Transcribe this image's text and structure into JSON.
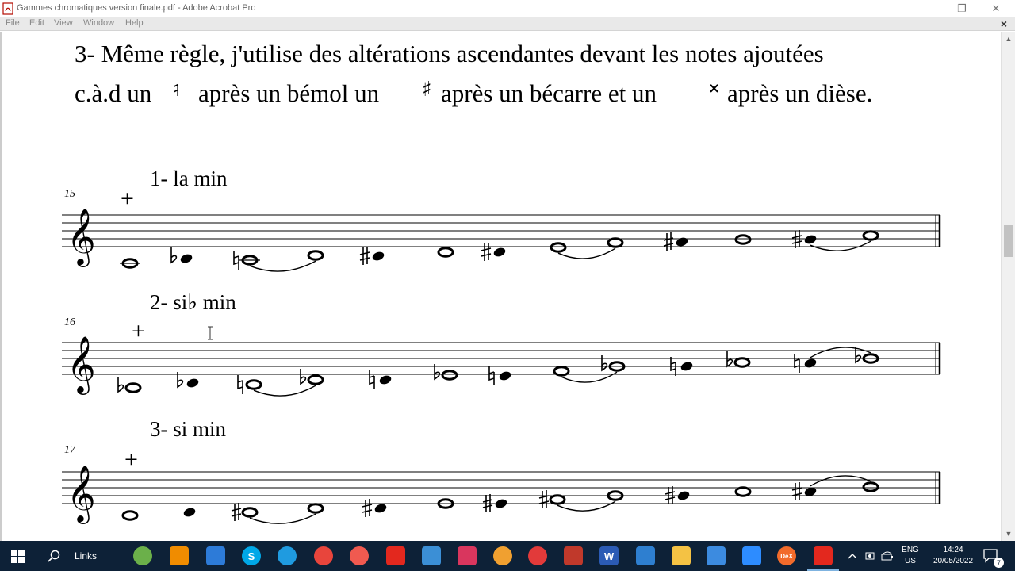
{
  "window": {
    "title": "Gammes chromatiques version finale.pdf - Adobe Acrobat Pro",
    "controls": {
      "minimize": "—",
      "restore": "❐",
      "close": "✕"
    }
  },
  "menubar": {
    "items": [
      {
        "label": "File"
      },
      {
        "label": "Edit"
      },
      {
        "label": "View"
      },
      {
        "label": "Window"
      },
      {
        "label": "Help"
      }
    ],
    "close": "×"
  },
  "document": {
    "rule_line1": "3- Même règle, j'utilise des altérations ascendantes devant les notes ajoutées",
    "rule_line2_a": "c.à.d un",
    "rule_line2_b": "après un bémol un",
    "rule_line2_c": "après un bécarre et un",
    "rule_line2_d": "après un dièse.",
    "glyph_natural": "♮",
    "glyph_sharp": "♯",
    "glyph_double_sharp": "𝄪",
    "staves": [
      {
        "measure": "15",
        "title": "1- la min"
      },
      {
        "measure": "16",
        "title": "2- si♭ min"
      },
      {
        "measure": "17",
        "title": "3- si min"
      }
    ],
    "cross_mark": "+"
  },
  "scrollbar": {
    "up": "▲",
    "down": "▼"
  },
  "taskbar": {
    "search_label": "Links",
    "apps": [
      {
        "name": "globe-app-icon",
        "color": "#6bb04a"
      },
      {
        "name": "vlc-icon",
        "color": "#f08c00"
      },
      {
        "name": "store-icon",
        "color": "#2d7bd8"
      },
      {
        "name": "skype-icon",
        "color": "#00a8e8",
        "glyph": "S"
      },
      {
        "name": "edge-icon",
        "color": "#1f9be0"
      },
      {
        "name": "chrome-icon",
        "color": "#e8453c"
      },
      {
        "name": "red-a-app-icon",
        "color": "#f05a50"
      },
      {
        "name": "acrobat-taskbar-icon",
        "color": "#e3281e"
      },
      {
        "name": "pen-app-icon",
        "color": "#3b8fd6"
      },
      {
        "name": "diamond-app-icon",
        "color": "#d9365e"
      },
      {
        "name": "calc-app-icon",
        "color": "#f0a030"
      },
      {
        "name": "record-app-icon",
        "color": "#e23a3a"
      },
      {
        "name": "box-app-icon",
        "color": "#c0392b"
      },
      {
        "name": "word-icon",
        "color": "#2b5bb5",
        "glyph": "W"
      },
      {
        "name": "mail-icon",
        "color": "#2e7fd0"
      },
      {
        "name": "file-explorer-icon",
        "color": "#f4c244"
      },
      {
        "name": "media-app-icon",
        "color": "#3c8be0"
      },
      {
        "name": "zoom-icon",
        "color": "#2d8cff"
      },
      {
        "name": "dex-icon",
        "color": "#f26b2b",
        "glyph": "DeX"
      },
      {
        "name": "acrobat-active-icon",
        "color": "#e3281e"
      }
    ],
    "lang_top": "ENG",
    "lang_bottom": "US",
    "time": "14:24",
    "date": "20/05/2022",
    "notification_count": "7"
  }
}
